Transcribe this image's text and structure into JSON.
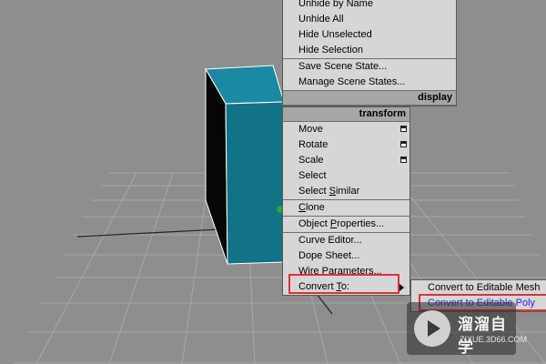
{
  "scene": {
    "background_color": "#8e8e8e",
    "grid_color": "#a7a7a7",
    "cube_front_color": "#127286",
    "cube_top_color": "#198aa2",
    "cube_side_color": "#060606"
  },
  "display_menu": {
    "header": "display",
    "items": [
      {
        "label": "Unhide by Name"
      },
      {
        "label": "Unhide All"
      },
      {
        "label": "Hide Unselected"
      },
      {
        "label": "Hide Selection"
      },
      {
        "label": "Save Scene State..."
      },
      {
        "label": "Manage Scene States..."
      }
    ]
  },
  "transform_menu": {
    "header": "transform",
    "move": "Move",
    "rotate": "Rotate",
    "scale": "Scale",
    "select": "Select",
    "select_similar_pre": "Select ",
    "select_similar_u": "S",
    "select_similar_post": "imilar",
    "clone_u": "C",
    "clone_post": "lone",
    "object_props_pre": "Object ",
    "object_props_u": "P",
    "object_props_post": "roperties...",
    "curve_editor": "Curve Editor...",
    "dope_sheet": "Dope Sheet...",
    "wire_parameters": "Wire Parameters...",
    "convert_to_pre": "Convert ",
    "convert_to_u": "T",
    "convert_to_post": "o:"
  },
  "submenu": {
    "items": [
      {
        "label": "Convert to Editable Mesh"
      },
      {
        "label": "Convert to Editable Poly"
      }
    ]
  },
  "highlight_color": "#e0303a",
  "watermark": {
    "title": "溜溜自学",
    "url": "ZIXUE.3D66.COM"
  }
}
